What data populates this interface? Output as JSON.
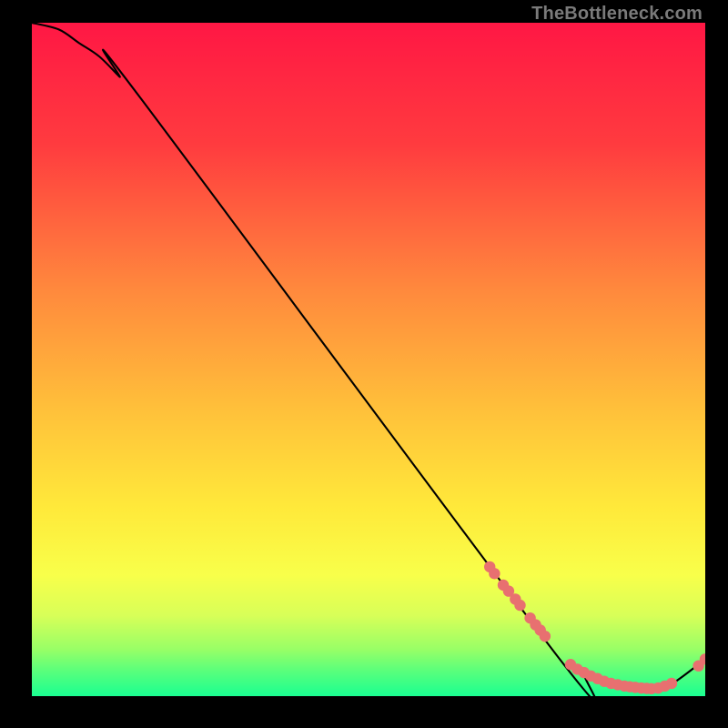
{
  "attribution": "TheBottleneck.com",
  "chart_data": {
    "type": "line",
    "title": "",
    "xlabel": "",
    "ylabel": "",
    "xlim": [
      0,
      100
    ],
    "ylim": [
      0,
      100
    ],
    "gradient_stops": [
      {
        "offset": 0,
        "color": "#ff1744"
      },
      {
        "offset": 18,
        "color": "#ff3b3f"
      },
      {
        "offset": 40,
        "color": "#ff8a3d"
      },
      {
        "offset": 58,
        "color": "#ffc23a"
      },
      {
        "offset": 72,
        "color": "#ffe93a"
      },
      {
        "offset": 82,
        "color": "#f8ff4a"
      },
      {
        "offset": 88,
        "color": "#d8ff58"
      },
      {
        "offset": 93,
        "color": "#99ff66"
      },
      {
        "offset": 96,
        "color": "#5eff7a"
      },
      {
        "offset": 100,
        "color": "#1aff91"
      }
    ],
    "series": [
      {
        "name": "bottleneck-curve",
        "type": "line",
        "x": [
          0,
          4,
          7,
          10,
          13,
          16,
          78,
          82,
          85,
          88,
          92,
          95,
          100
        ],
        "y": [
          100,
          99,
          97,
          95,
          92,
          89,
          6,
          3.5,
          2,
          1.3,
          1,
          1.8,
          5.5
        ]
      },
      {
        "name": "markers-top-cluster",
        "type": "scatter",
        "color": "#e87070",
        "x": [
          68,
          68.7,
          70,
          70.8,
          71.8,
          72.5,
          74,
          74.8,
          75.5,
          76.2
        ],
        "y": [
          19.2,
          18.2,
          16.5,
          15.6,
          14.4,
          13.5,
          11.6,
          10.6,
          9.8,
          8.9
        ]
      },
      {
        "name": "markers-bottom-cluster",
        "type": "scatter",
        "color": "#e87070",
        "x": [
          80,
          81,
          82,
          83,
          84,
          85,
          86,
          87,
          88,
          88.8,
          89.6,
          90.5,
          91.3,
          92,
          93,
          94,
          95
        ],
        "y": [
          4.7,
          4.0,
          3.5,
          3.0,
          2.6,
          2.2,
          1.9,
          1.7,
          1.5,
          1.4,
          1.3,
          1.2,
          1.15,
          1.1,
          1.2,
          1.5,
          1.9
        ]
      },
      {
        "name": "markers-right-tail",
        "type": "scatter",
        "color": "#e87070",
        "x": [
          99.0,
          100.0
        ],
        "y": [
          4.5,
          5.5
        ]
      }
    ]
  }
}
